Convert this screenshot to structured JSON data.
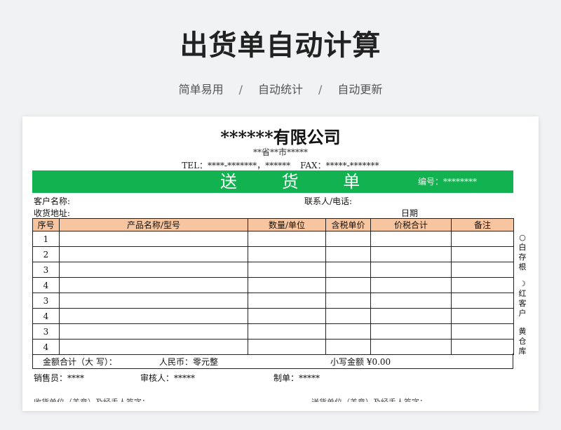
{
  "header": {
    "title": "出货单自动计算",
    "features": [
      "简单易用",
      "自动统计",
      "自动更新"
    ],
    "separator": "/"
  },
  "sheet": {
    "company": "******有限公司",
    "address": "**省**市*****",
    "tel": "TEL：****-*******，******",
    "fax": "FAX：*****-*******",
    "doc_title": "送 货 单",
    "serial": "编号：********",
    "customer_label": "客户名称:",
    "contact_label": "联系人/电话:",
    "address_label": "收货地址:",
    "date_label": "日期",
    "columns": [
      "序号",
      "产品名称/型号",
      "数量/单位",
      "含税单价",
      "价税合计",
      "备注"
    ],
    "rows": [
      "1",
      "2",
      "3",
      "4",
      "3",
      "4",
      "3",
      "4"
    ],
    "total_label": "金额合计（大  写）：",
    "rmb_label": "人民币：零元整",
    "small_total_label": "小写金额 ¥0.00",
    "salesperson": "销售员：****",
    "reviewer": "审核人：*****",
    "maker": "制单：*****",
    "copies": [
      {
        "mark": "○",
        "text": "白存根"
      },
      {
        "mark": "☽",
        "text": "红客户"
      },
      {
        "mark": "",
        "text": "黄仓库"
      }
    ],
    "cut_left": "收货单位（盖章）及经手人签字：",
    "cut_right": "送货单位（盖章）及经手人签字："
  }
}
